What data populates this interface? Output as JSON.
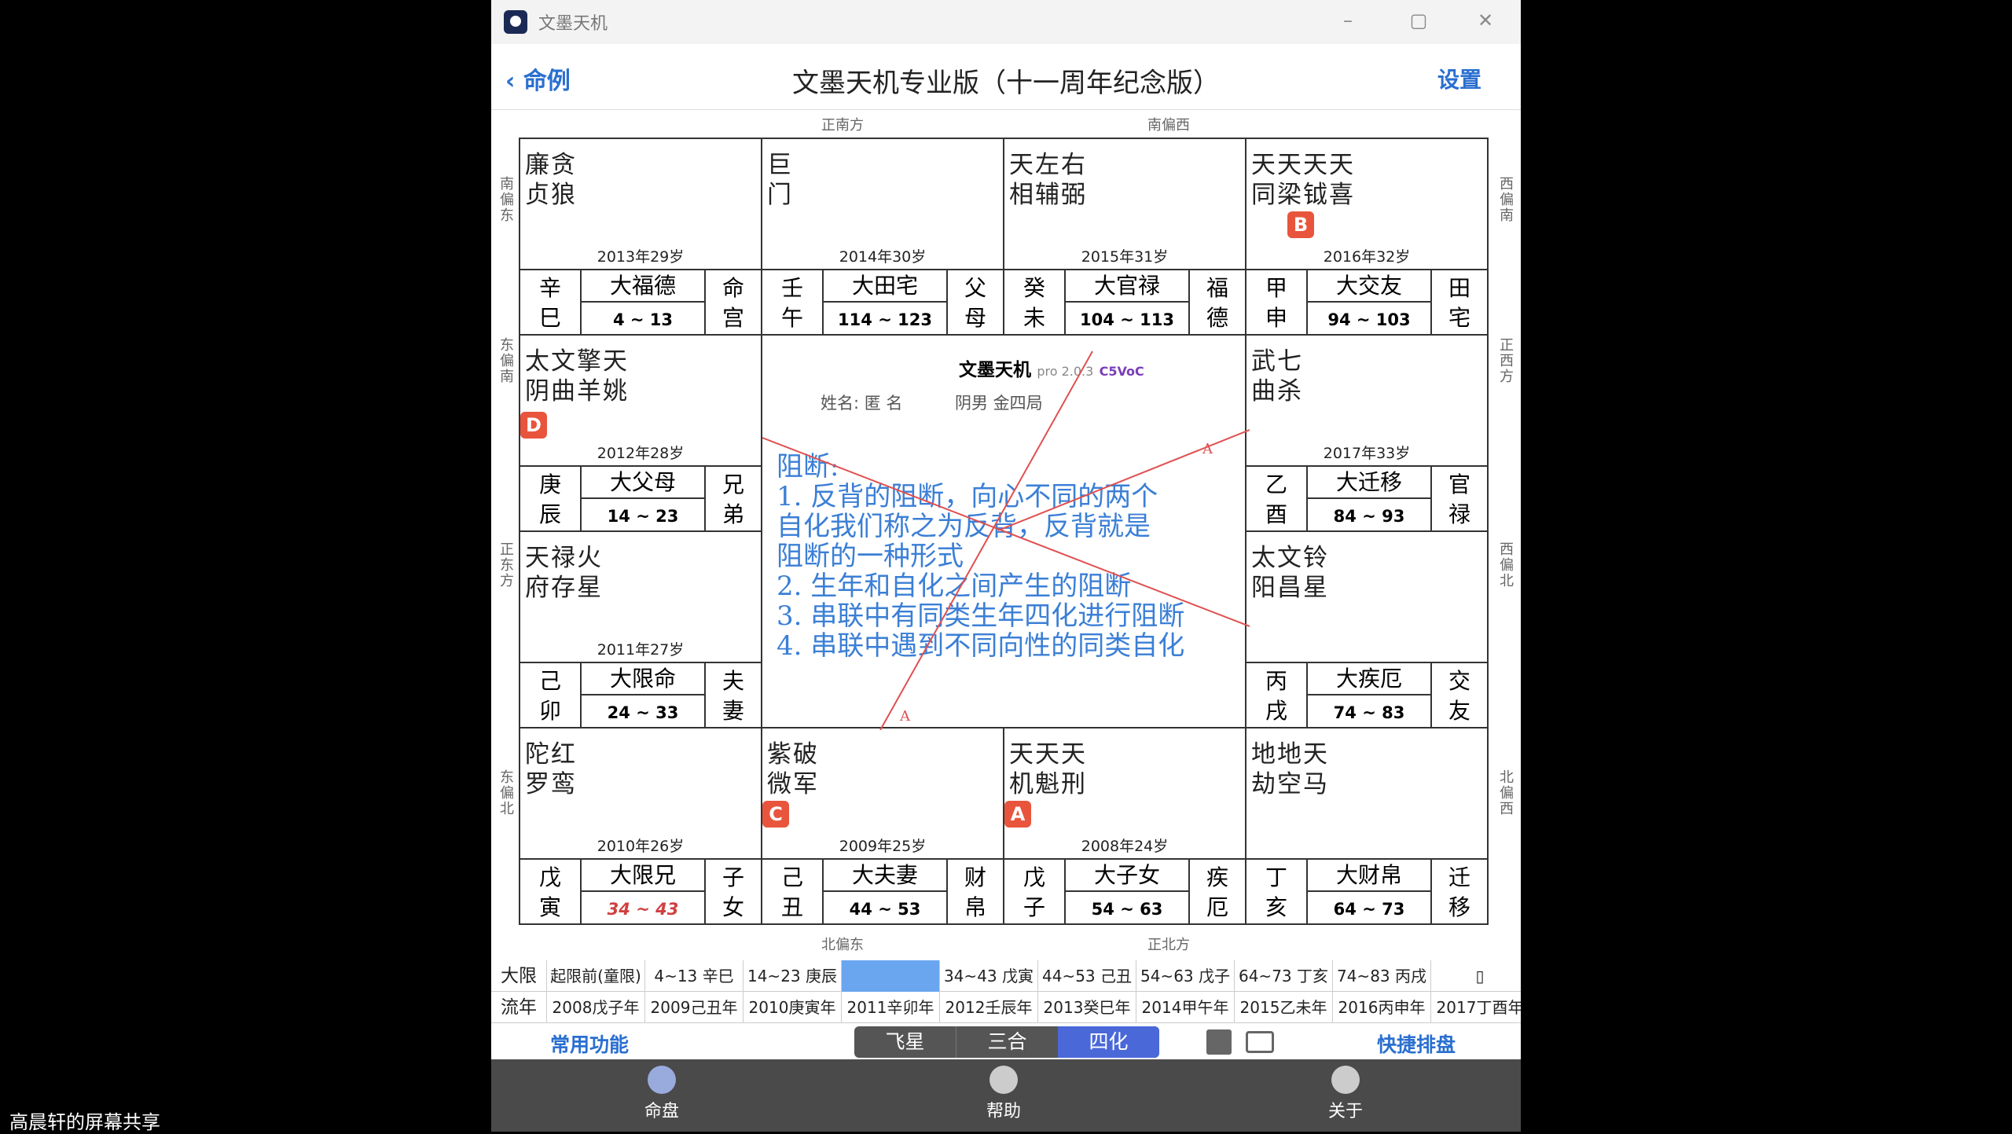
{
  "window": {
    "title": "文墨天机"
  },
  "nav": {
    "back": "命例",
    "title": "文墨天机专业版（十一周年纪念版）",
    "settings": "设置"
  },
  "directions": {
    "top_left": "正南方",
    "top_right": "南偏西",
    "bottom_left": "北偏东",
    "bottom_right": "正北方",
    "left": [
      "南偏东",
      "东偏南",
      "正东方",
      "东偏北"
    ],
    "right": [
      "西偏南",
      "正西方",
      "西偏北",
      "北偏西"
    ]
  },
  "palaces": [
    {
      "stars": "廉贪\n贞狼",
      "age": "2013年29岁",
      "gz": "辛\n巳",
      "dx": "大福德",
      "rng": "4 ~ 13",
      "gong": "命\n宫"
    },
    {
      "stars": "巨\n门",
      "age": "2014年30岁",
      "gz": "壬\n午",
      "dx": "大田宅",
      "rng": "114 ~ 123",
      "gong": "父\n母"
    },
    {
      "stars": "天左右\n相辅弼",
      "age": "2015年31岁",
      "gz": "癸\n未",
      "dx": "大官禄",
      "rng": "104 ~ 113",
      "gong": "福\n德"
    },
    {
      "stars": "天天天天\n同梁钺喜",
      "age": "2016年32岁",
      "gz": "甲\n申",
      "dx": "大交友",
      "rng": "94 ~ 103",
      "gong": "田\n宅",
      "badge": "B"
    },
    {
      "stars": "太文擎天\n阴曲羊姚",
      "age": "2012年28岁",
      "gz": "庚\n辰",
      "dx": "大父母",
      "rng": "14 ~ 23",
      "gong": "兄\n弟",
      "badge": "D"
    },
    {
      "stars": "武七\n曲杀",
      "age": "2017年33岁",
      "gz": "乙\n酉",
      "dx": "大迁移",
      "rng": "84 ~ 93",
      "gong": "官\n禄"
    },
    {
      "stars": "天禄火\n府存星",
      "age": "2011年27岁",
      "gz": "己\n卯",
      "dx": "大限命",
      "rng": "24 ~ 33",
      "gong": "夫\n妻"
    },
    {
      "stars": "太文铃\n阳昌星",
      "age": "",
      "gz": "丙\n戌",
      "dx": "大疾厄",
      "rng": "74 ~ 83",
      "gong": "交\n友"
    },
    {
      "stars": "陀红\n罗鸾",
      "age": "2010年26岁",
      "gz": "戊\n寅",
      "dx": "大限兄",
      "rng": "34 ~ 43",
      "gong": "子\n女"
    },
    {
      "stars": "紫破\n微军",
      "age": "2009年25岁",
      "gz": "己\n丑",
      "dx": "大夫妻",
      "rng": "44 ~ 53",
      "gong": "财\n帛",
      "badge": "C"
    },
    {
      "stars": "天天天\n机魁刑",
      "age": "2008年24岁",
      "gz": "戊\n子",
      "dx": "大子女",
      "rng": "54 ~ 63",
      "gong": "疾\n厄",
      "badge": "A"
    },
    {
      "stars": "地地天\n劫空马",
      "age": "",
      "gz": "丁\n亥",
      "dx": "大财帛",
      "rng": "64 ~ 73",
      "gong": "迁\n移"
    }
  ],
  "center": {
    "app": "文墨天机",
    "ver": "pro 2.0.3",
    "code": "C5VoC",
    "name": "姓名: 匿 名",
    "info": "阴男 金四局",
    "notes": [
      "阻断:",
      "1. 反背的阻断，向心不同的两个",
      "自化我们称之为反背，反背就是",
      "阻断的一种形式",
      "2. 生年和自化之间产生的阻断",
      "3. 串联中有同类生年四化进行阻断",
      "4. 串联中遇到不同向性的同类自化"
    ],
    "marks": {
      "a1": "A",
      "a2": "A",
      "c": "C",
      "d": "D"
    }
  },
  "daxian": {
    "label": "大限",
    "items": [
      "起限前(童限)",
      "4~13 辛巳",
      "14~23 庚辰",
      "",
      "34~43 戊寅",
      "44~53 己丑",
      "54~63 戊子",
      "64~73 丁亥",
      "74~83 丙戌",
      "▯"
    ]
  },
  "liunian": {
    "label": "流年",
    "items": [
      "2008戊子年",
      "2009己丑年",
      "2010庚寅年",
      "2011辛卯年",
      "2012壬辰年",
      "2013癸巳年",
      "2014甲午年",
      "2015乙未年",
      "2016丙申年",
      "2017丁酉年"
    ]
  },
  "toolbar": {
    "common": "常用功能",
    "fly": "飞星",
    "sanhe": "三合",
    "sihua": "四化",
    "quick": "快捷排盘"
  },
  "tabs": [
    "命盘",
    "帮助",
    "关于"
  ],
  "share": "高晨轩的屏幕共享",
  "colors": {
    "accent": "#2a6fd0",
    "badge": "#e8553c",
    "note": "#3b7fd6",
    "line": "#e05050"
  }
}
